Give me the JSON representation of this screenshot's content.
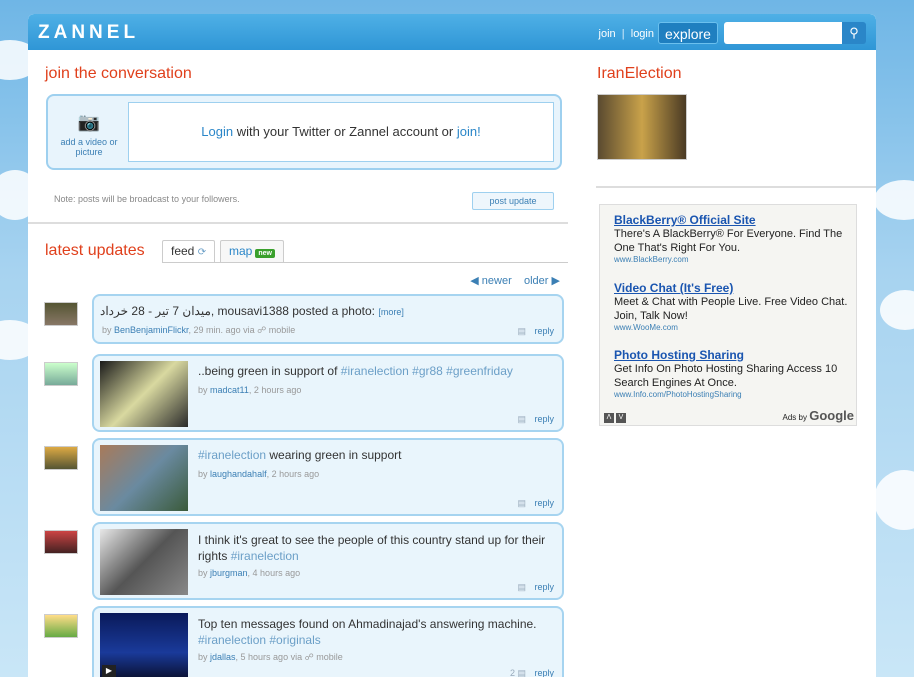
{
  "header": {
    "logo": "ZANNEL",
    "join": "join",
    "sep": "|",
    "login": "login",
    "explore": "explore",
    "search_placeholder": ""
  },
  "compose": {
    "title": "join the conversation",
    "add_media": "add a video or picture",
    "login_link": "Login",
    "login_mid": " with your Twitter or Zannel account or ",
    "join_link": "join!",
    "note": "Note: posts will be broadcast to your followers.",
    "post_button": "post update"
  },
  "updates": {
    "title": "latest updates",
    "tab_feed": "feed",
    "tab_map": "map",
    "badge_new": "new",
    "newer": "newer",
    "older": "older",
    "items": [
      {
        "text_rtl": "میدان 7 تیر - 28 خرداد",
        "text": ", mousavi1388 posted a photo:",
        "more": "[more]",
        "user": "BenBenjaminFlickr",
        "time": ", 29 min. ago via",
        "via": "mobile",
        "reply": "reply",
        "count": ""
      },
      {
        "text": "..being green in support of ",
        "tags": "#iranelection #gr88 #greenfriday",
        "user": "madcat11",
        "time": ", 2 hours ago",
        "reply": "reply",
        "count": ""
      },
      {
        "tags": "#iranelection",
        "text": " wearing green in support",
        "user": "laughandahalf",
        "time": ", 2 hours ago",
        "reply": "reply",
        "count": ""
      },
      {
        "text": "I think it's great to see the people of this country stand up for their rights ",
        "tags": "#iranelection",
        "user": "jburgman",
        "time": ", 4 hours ago",
        "reply": "reply",
        "count": ""
      },
      {
        "text": "Top ten messages found on Ahmadinajad's answering machine. ",
        "tags": "#iranelection #originals",
        "user": "jdallas",
        "time": ", 5 hours ago via",
        "via": "mobile",
        "reply": "reply",
        "count": "2"
      }
    ]
  },
  "sidebar": {
    "title": "IranElection",
    "ads": [
      {
        "title": "BlackBerry® Official Site",
        "desc": "There's A BlackBerry® For Everyone. Find The One That's Right For You.",
        "url": "www.BlackBerry.com"
      },
      {
        "title": "Video Chat (It's Free)",
        "desc": "Meet & Chat with People Live. Free Video Chat. Join, Talk Now!",
        "url": "www.WooMe.com"
      },
      {
        "title": "Photo Hosting Sharing",
        "desc": "Get Info On Photo Hosting Sharing Access 10 Search Engines At Once.",
        "url": "www.Info.com/PhotoHostingSharing"
      }
    ],
    "ads_by": "Ads by",
    "google": "Google"
  },
  "colors": {
    "accent_red": "#e0401c",
    "link_blue": "#2a86c8",
    "bubble_bg": "#e9f5fc"
  }
}
